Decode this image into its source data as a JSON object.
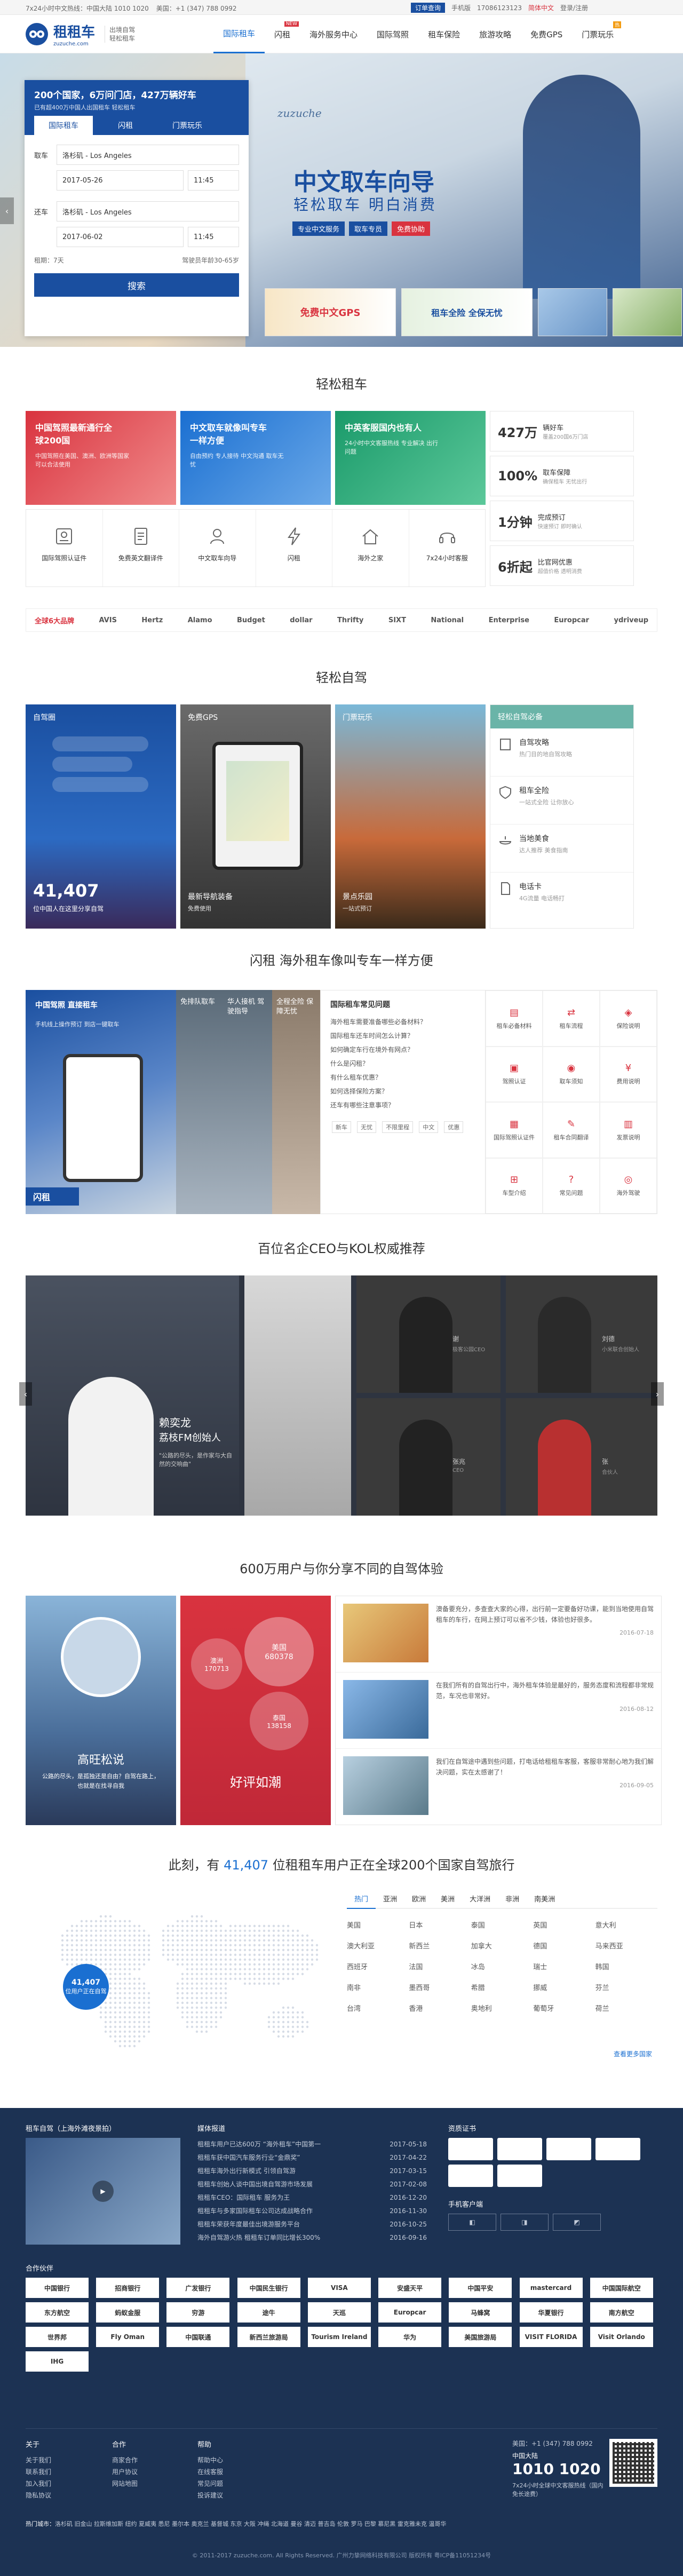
{
  "topbar": {
    "hotline": "7x24小时中文热线：中国大陆 1010 1020",
    "us_phone": "美国：+1 (347) 788 0992",
    "lang": "简体中文",
    "login": "登录/注册",
    "app": "手机版",
    "order": "订单查询",
    "service": "17086123123"
  },
  "nav": {
    "logo": "租租车",
    "logo_sub": "zuzuche.com",
    "slogan_1": "出境自驾",
    "slogan_2": "轻松租车",
    "items": [
      "国际租车",
      "闪租",
      "海外服务中心",
      "国际驾照",
      "租车保险",
      "旅游攻略",
      "免费GPS",
      "门票玩乐"
    ],
    "badge_new": "NEW",
    "badge_hot": "热"
  },
  "hero": {
    "headline": "200个国家，6万问门店，427万辆好车",
    "sub": "已有超400万中国人出国租车 轻松租车",
    "tab_1": "国际租车",
    "tab_2": "闪租",
    "tab_3": "门票玩乐",
    "pickup_label": "取车",
    "pickup_value": "洛杉矶 - Los Angeles",
    "pickup_date": "2017-05-26",
    "pickup_time": "11:45",
    "return_label": "还车",
    "return_value": "洛杉矶 - Los Angeles",
    "return_date": "2017-06-02",
    "return_time": "11:45",
    "days": "租期：7天",
    "age_note": "驾驶员年龄30-65岁",
    "search_btn": "搜索",
    "banner_title": "中文取车向导",
    "banner_sub": "轻松取车 明白消费",
    "banner_tags": [
      "专业中文服务",
      "取车专员",
      "免费协助"
    ],
    "promo_1": "免费中文GPS",
    "promo_2": "租车全险 全保无忧",
    "promo_3": "",
    "promo_4": ""
  },
  "section1": {
    "title": "轻松租车",
    "cards": [
      {
        "title": "中国驾照最新通行全球200国",
        "desc": "中国驾照在美国、澳洲、欧洲等国家可以合法使用"
      },
      {
        "title": "中文取车就像叫专车一样方便",
        "desc": "自由预约 专人接待 中文沟通 取车无忧"
      },
      {
        "title": "中英客服国内也有人",
        "desc": "24小时中文客服热线 专业解决 出行问题"
      }
    ],
    "stats": [
      {
        "num": "427万",
        "label": "辆好车",
        "desc": "覆盖200国6万门店"
      },
      {
        "num": "100%",
        "label": "取车保障",
        "desc": "确保租车 无忧出行"
      },
      {
        "num": "1分钟",
        "label": "完成预订",
        "desc": "快速预订 即时确认"
      },
      {
        "num": "6折起",
        "label": "比官网优惠",
        "desc": "超值价格 透明消费"
      }
    ],
    "features": [
      "国际驾照认证件",
      "免费英文翻译件",
      "中文取车向导",
      "闪租",
      "海外之家",
      "7x24小时客服"
    ],
    "brands": [
      "全球6大品牌",
      "AVIS",
      "Hertz",
      "Alamo",
      "Budget",
      "dollar",
      "Thrifty",
      "SIXT",
      "National",
      "Enterprise",
      "Europcar",
      "ydriveup"
    ]
  },
  "section2": {
    "title": "轻松自驾",
    "cards": [
      {
        "title": "自驾圈",
        "stat": "41,407",
        "stat_label": "位中国人在这里分享自驾"
      },
      {
        "title": "免费GPS",
        "caption": "最新导航装备",
        "caption_sub": "免费使用"
      },
      {
        "title": "门票玩乐",
        "caption": "景点乐园",
        "caption_sub": "一站式预订"
      }
    ],
    "guide_title": "轻松自驾必备",
    "guide_items": [
      {
        "title": "自驾攻略",
        "desc": "热门目的地自驾攻略"
      },
      {
        "title": "租车全险",
        "desc": "一站式全险 让你放心"
      },
      {
        "title": "当地美食",
        "desc": "达人推荐 美食指南"
      },
      {
        "title": "电话卡",
        "desc": "4G流量 电话畅打"
      }
    ]
  },
  "section3": {
    "title": "闪租 海外租车像叫专车一样方便",
    "card_text": "中国驾照 直接租车",
    "card_sub": "手机线上操作预订 到店一键取车",
    "flash_label": "闪租",
    "faq_title": "国际租车常见问题",
    "faq": [
      "海外租车需要准备哪些必备材料？",
      "国际租车还车时间怎么计算？",
      "如何确定车行在境外有网点？",
      "什么是闪租？",
      "有什么租车优惠？",
      "如何选择保险方案？",
      "还车有哪些注意事项？"
    ],
    "tiles": [
      {
        "title": "免排队取车"
      },
      {
        "title": "华人接机 驾驶指导"
      },
      {
        "title": "全程全险 保障无忧"
      }
    ],
    "grid": [
      "租车必备材料",
      "租车流程",
      "保险说明",
      "驾照认证",
      "取车须知",
      "费用说明",
      "国际驾照认证件",
      "租车合同翻译",
      "发票说明",
      "车型介绍",
      "常见问题",
      "海外驾驶"
    ],
    "tags": [
      "新车",
      "无忧",
      "不限里程",
      "中文",
      "优惠"
    ]
  },
  "section4": {
    "title": "百位名企CEO与KOL权威推荐",
    "left_quote_name": "赖奕龙",
    "left_quote_title": "荔枝FM创始人",
    "left_quote_text": "\"公路的尽头，是作家与大自然的交响曲\"",
    "people": [
      {
        "name": "刘德",
        "role": "小米联合创始人"
      },
      {
        "name": "谢",
        "role": "极客公园CEO"
      },
      {
        "name": "张兆",
        "role": "CEO"
      },
      {
        "name": "张",
        "role": "合伙人"
      }
    ]
  },
  "section5": {
    "title": "600万用户与你分享不同的自驾体验",
    "left_caption": "高旺松说",
    "left_desc": "公路的尽头，是孤独还是自由？自驾在路上，也就是在找寻自我",
    "right_caption": "好评如潮",
    "stats": [
      {
        "place": "美国",
        "count": "680378"
      },
      {
        "place": "澳洲",
        "count": "170713"
      },
      {
        "place": "泰国",
        "count": "138158"
      }
    ],
    "reviews": [
      {
        "text": "澳备要充分，多查查大家的心得，出行前一定要备好功课，能到当地使用自驾租车的车行，在网上预订可以省不少钱，体验也好很多。",
        "date": "2016-07-18"
      },
      {
        "text": "在我们所有的自驾出行中，海外租车体验是最好的，服务态度和流程都非常规范，车况也非常好。",
        "date": "2016-08-12"
      },
      {
        "text": "我们在自驾途中遇到些问题，打电话给租租车客服，客服非常耐心地为我们解决问题，实在太感谢了！",
        "date": "2016-09-05"
      }
    ]
  },
  "section6": {
    "title_pre": "此刻，有",
    "count": "41,407",
    "title_post": "位租租车用户正在全球200个国家自驾旅行",
    "tabs": [
      "热门",
      "亚洲",
      "欧洲",
      "美洲",
      "大洋洲",
      "非洲",
      "南美洲"
    ],
    "countries": [
      "美国",
      "日本",
      "泰国",
      "英国",
      "意大利",
      "澳大利亚",
      "新西兰",
      "加拿大",
      "德国",
      "马来西亚",
      "西班牙",
      "法国",
      "冰岛",
      "瑞士",
      "韩国",
      "南非",
      "墨西哥",
      "希腊",
      "挪威",
      "芬兰",
      "台湾",
      "香港",
      "奥地利",
      "葡萄牙",
      "荷兰"
    ],
    "more": "查看更多国家",
    "map_stat": "41,407",
    "map_label": "位用户正在自驾"
  },
  "footer": {
    "col1_title": "租车自驾（上海外滩夜景拍）",
    "col2_title": "媒体报道",
    "col3_title": "资质证书",
    "col4_title": "手机客户端",
    "media": [
      {
        "text": "租租车用户已达600万 “海外租车”中国第一",
        "date": "2017-05-18"
      },
      {
        "text": "租租车获中国汽车服务行业“金鼎奖”",
        "date": "2017-04-22"
      },
      {
        "text": "租租车海外出行新模式 引领自驾游",
        "date": "2017-03-15"
      },
      {
        "text": "租租车创始人谈中国出境自驾游市场发展",
        "date": "2017-02-08"
      },
      {
        "text": "租租车CEO：国际租车 服务为王",
        "date": "2016-12-20"
      },
      {
        "text": "租租车与多家国际租车公司达成战略合作",
        "date": "2016-11-30"
      },
      {
        "text": "租租车荣获年度最佳出境游服务平台",
        "date": "2016-10-25"
      },
      {
        "text": "海外自驾游火热 租租车订单同比增长300%",
        "date": "2016-09-16"
      }
    ],
    "partners_title": "合作伙伴",
    "partners": [
      "中国银行",
      "招商银行",
      "广发银行",
      "中国民生银行",
      "VISA",
      "安盛天平",
      "中国平安",
      "mastercard",
      "中国国际航空",
      "东方航空",
      "蚂蚁金服",
      "穷游",
      "途牛",
      "天巡",
      "Europcar",
      "马蜂窝",
      "华夏银行",
      "南方航空",
      "世界邦",
      "Fly Oman",
      "中国联通",
      "新西兰旅游局",
      "Tourism Ireland",
      "华为",
      "美国旅游局",
      "VISIT FLORIDA",
      "Visit Orlando",
      "IHG",
      "",
      ""
    ],
    "links_1_title": "关于",
    "links_1": [
      "关于我们",
      "联系我们",
      "加入我们",
      "隐私协议"
    ],
    "links_2_title": "合作",
    "links_2": [
      "商家合作",
      "用户协议",
      "网站地图"
    ],
    "links_3_title": "帮助",
    "links_3": [
      "帮助中心",
      "在线客服",
      "常见问题",
      "投诉建议"
    ],
    "phone_us": "美国：+1 (347) 788 0992",
    "phone_cn_label": "中国大陆",
    "phone_cn": "1010 1020",
    "phone_note": "7x24小时全球中文客服热线（国内免长途费）",
    "hot_label": "热门城市：",
    "hot_cities": "洛杉矶 旧金山 拉斯维加斯 纽约 夏威夷 悉尼 墨尔本 奥克兰 基督城 东京 大阪 冲绳 北海道 曼谷 清迈 普吉岛 伦敦 罗马 巴黎 慕尼黑 雷克雅未克 温哥华",
    "copyright": "© 2011-2017 zuzuche.com. All Rights Reserved. 广州力挚网络科技有限公司 版权所有 粤ICP备11051234号"
  },
  "colors": {
    "brand_blue": "#1a4fa0",
    "link_blue": "#1a6fd1",
    "red": "#d9333f",
    "orange": "#f39c12",
    "footer_bg": "#1c3253"
  }
}
